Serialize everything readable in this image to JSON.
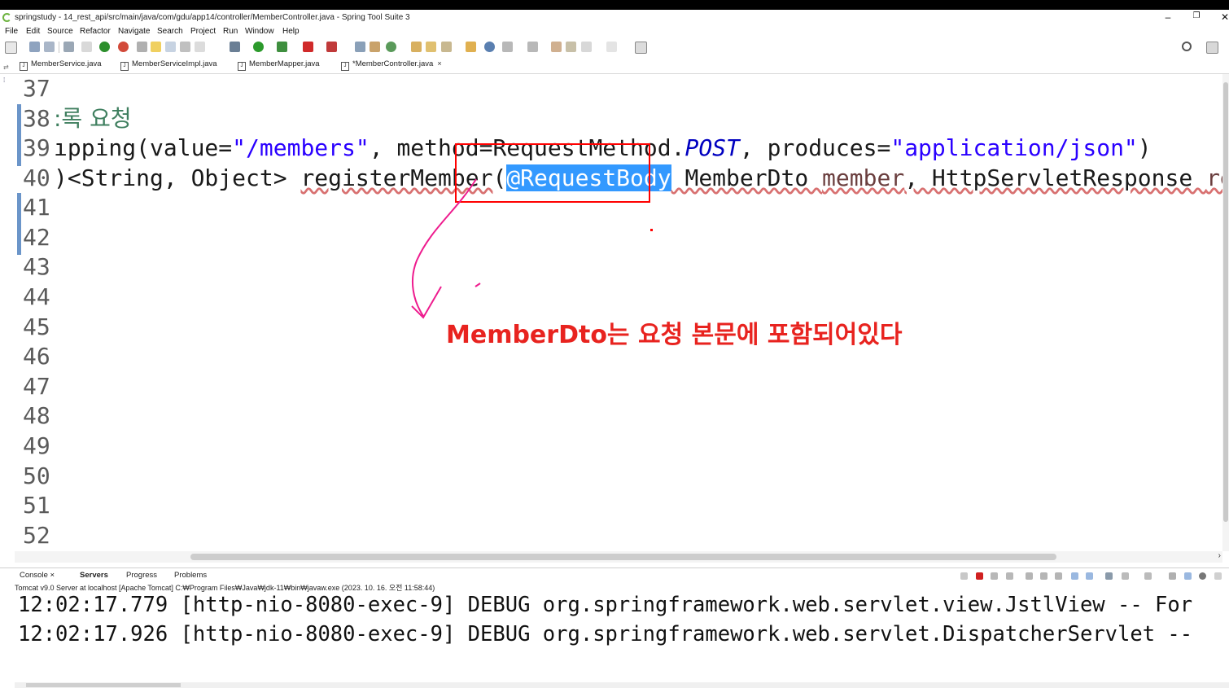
{
  "window": {
    "title": "springstudy - 14_rest_api/src/main/java/com/gdu/app14/controller/MemberController.java - Spring Tool Suite 3",
    "controls": {
      "minimize": "–",
      "restore": "❐",
      "close": "✕"
    }
  },
  "menu": [
    "File",
    "Edit",
    "Source",
    "Refactor",
    "Navigate",
    "Search",
    "Project",
    "Run",
    "Window",
    "Help"
  ],
  "tabs": [
    {
      "label": "MemberService.java",
      "active": false
    },
    {
      "label": "MemberServiceImpl.java",
      "active": false
    },
    {
      "label": "MemberMapper.java",
      "active": false
    },
    {
      "label": "*MemberController.java",
      "active": true,
      "close": "×"
    }
  ],
  "editor": {
    "line_numbers": [
      "37",
      "38",
      "39",
      "40",
      "41",
      "42",
      "43",
      "44",
      "45",
      "46",
      "47",
      "48",
      "49",
      "50",
      "51",
      "52"
    ],
    "line38": {
      "comment": ":록 요청"
    },
    "line39": {
      "t1": "ıpping(value=",
      "t2": "\"/members\"",
      "t3": ", method=RequestMethod.",
      "t4": "POST",
      "t5": ", produces=",
      "t6": "\"application/json\"",
      "t7": ")"
    },
    "line40": {
      "t1": ")<String, Object> ",
      "t2": "registerMember",
      "t3": "(",
      "t4": "@RequestBody",
      "t5": " MemberDto ",
      "t6": "member",
      "t7": ", HttpServletResponse ",
      "t8": "respons"
    }
  },
  "annotation": {
    "text": "MemberDto는 요청 본문에 포함되어있다",
    "color": "#e8231f"
  },
  "console": {
    "tabs": [
      "Console",
      "Servers",
      "Progress",
      "Problems"
    ],
    "header": "Tomcat v9.0 Server at localhost [Apache Tomcat] C:₩Program Files₩Java₩jdk-11₩bin₩javaw.exe  (2023. 10. 16. 오전 11:58:44)",
    "lines": [
      "12:02:17.779 [http-nio-8080-exec-9] DEBUG org.springframework.web.servlet.view.JstlView -- For",
      "12:02:17.926 [http-nio-8080-exec-9] DEBUG org.springframework.web.servlet.DispatcherServlet --"
    ]
  },
  "colors": {
    "accent_selection": "#3399ff",
    "annotation_red": "#ff0000",
    "string_blue": "#2a00ff"
  }
}
